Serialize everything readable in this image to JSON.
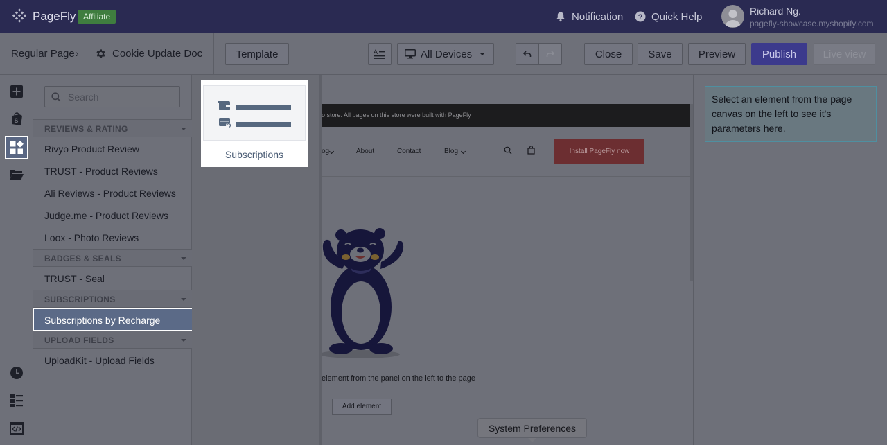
{
  "topbar": {
    "brand": "PageFly",
    "affiliate_badge": "Affiliate",
    "notification_label": "Notification",
    "quick_help_label": "Quick Help",
    "user_name": "Richard Ng.",
    "user_store": "pagefly-showcase.myshopify.com"
  },
  "toolbar": {
    "breadcrumb_root": "Regular Page",
    "breadcrumb_separator": "›",
    "page_name": "Cookie Update Doc",
    "template_label": "Template",
    "devices_label": "All Devices",
    "close_label": "Close",
    "save_label": "Save",
    "preview_label": "Preview",
    "publish_label": "Publish",
    "live_view_label": "Live view"
  },
  "rail": {
    "icons": [
      "add-icon",
      "shopify-icon",
      "elements-grid-icon",
      "folder-icon",
      "history-icon",
      "layers-icon",
      "code-icon"
    ]
  },
  "element_panel": {
    "search_placeholder": "Search",
    "sections": [
      {
        "label": "REVIEWS & RATING",
        "items": [
          "Rivyo Product Review",
          "TRUST - Product Reviews",
          "Ali Reviews - Product Reviews",
          "Judge.me - Product Reviews",
          "Loox - Photo Reviews"
        ]
      },
      {
        "label": "BADGES & SEALS",
        "items": [
          "TRUST - Seal"
        ]
      },
      {
        "label": "SUBSCRIPTIONS",
        "items": [
          "Subscriptions by Recharge"
        ]
      },
      {
        "label": "UPLOAD FIELDS",
        "items": [
          "UploadKit - Upload Fields"
        ]
      }
    ],
    "selected_item": "Subscriptions by Recharge"
  },
  "popover": {
    "card_label": "Subscriptions"
  },
  "canvas": {
    "announcement": "o store. All pages on this store were built with PageFly",
    "nav": [
      "og",
      "About",
      "Contact",
      "Blog"
    ],
    "install_button": "Install PageFly now",
    "drag_hint": "element from the panel on the left to the page",
    "add_element_label": "Add element"
  },
  "right_panel": {
    "info_text": "Select an element from the page canvas on the left to see it's parameters here."
  },
  "tooltip": {
    "text": "System Preferences"
  },
  "colors": {
    "topbar_bg": "#2a2a52",
    "publish_bg": "#3c3a8c",
    "install_bg": "#6c2e31",
    "selected_item_bg": "#5b6a87"
  }
}
